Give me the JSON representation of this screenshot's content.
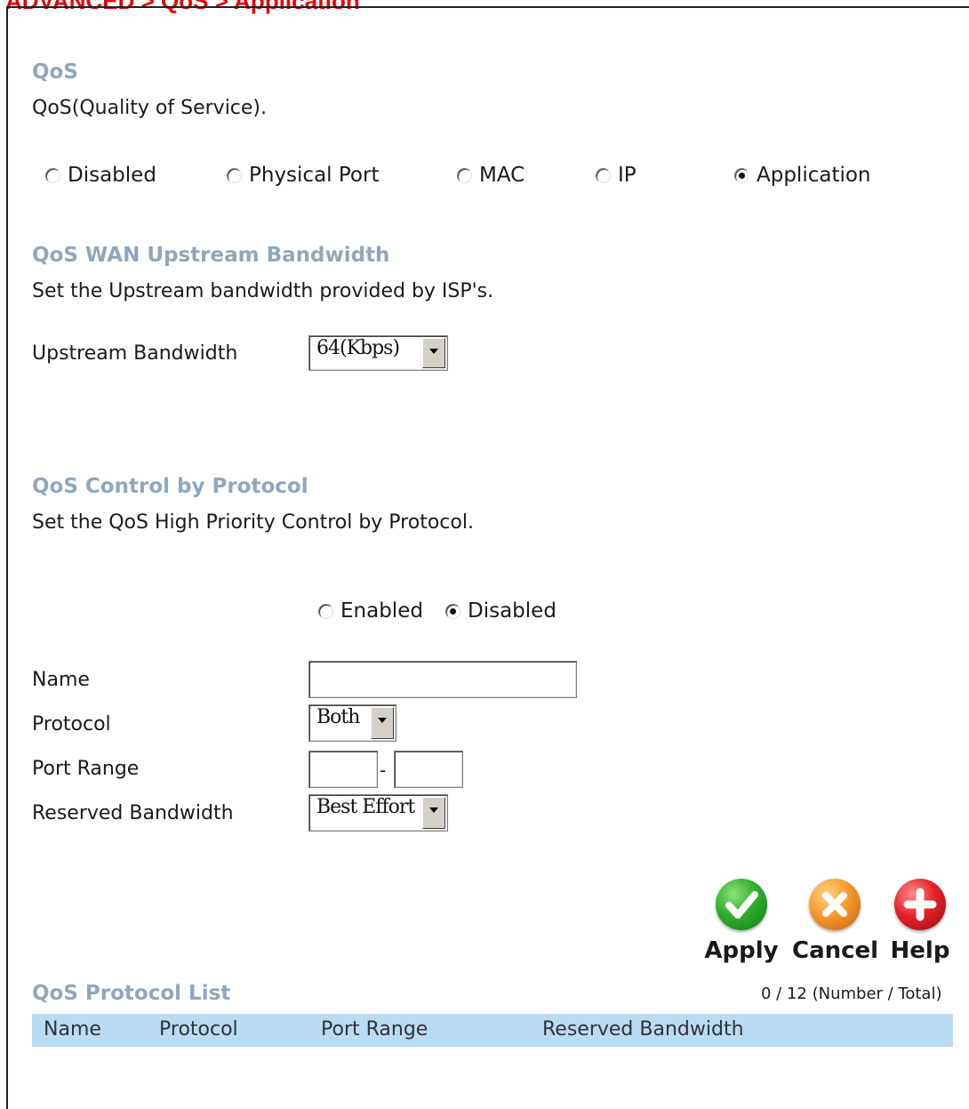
{
  "breadcrumb": "ADVANCED > QoS > Application",
  "qos": {
    "title": "QoS",
    "description": "QoS(Quality of Service).",
    "modes": [
      {
        "label": "Disabled",
        "checked": false
      },
      {
        "label": "Physical Port",
        "checked": false
      },
      {
        "label": "MAC",
        "checked": false
      },
      {
        "label": "IP",
        "checked": false
      },
      {
        "label": "Application",
        "checked": true
      }
    ]
  },
  "wan": {
    "title": "QoS WAN Upstream Bandwidth",
    "description": "Set the Upstream bandwidth provided by ISP's.",
    "bandwidth_label": "Upstream Bandwidth",
    "bandwidth_value": "64(Kbps)"
  },
  "control": {
    "title": "QoS Control by Protocol",
    "description": "Set the QoS High Priority Control by Protocol.",
    "enabled_label": "Enabled",
    "disabled_label": "Disabled",
    "selected": "Disabled",
    "name_label": "Name",
    "name_value": "",
    "protocol_label": "Protocol",
    "protocol_value": "Both",
    "port_range_label": "Port Range",
    "port_range_separator": "-",
    "port_from": "",
    "port_to": "",
    "reserved_label": "Reserved Bandwidth",
    "reserved_value": "Best Effort"
  },
  "actions": {
    "apply": "Apply",
    "cancel": "Cancel",
    "help": "Help",
    "colors": {
      "apply": "#1f9e2c",
      "cancel": "#f08a1c",
      "help": "#d9161c"
    }
  },
  "list": {
    "title": "QoS Protocol List",
    "counter": "0 / 12 (Number / Total)",
    "columns": [
      "Name",
      "Protocol",
      "Port Range",
      "Reserved Bandwidth"
    ],
    "header_color": "#b9dcf5",
    "rows": []
  },
  "colors": {
    "breadcrumb": "#e8000a",
    "section_title": "#8fa7bd"
  }
}
